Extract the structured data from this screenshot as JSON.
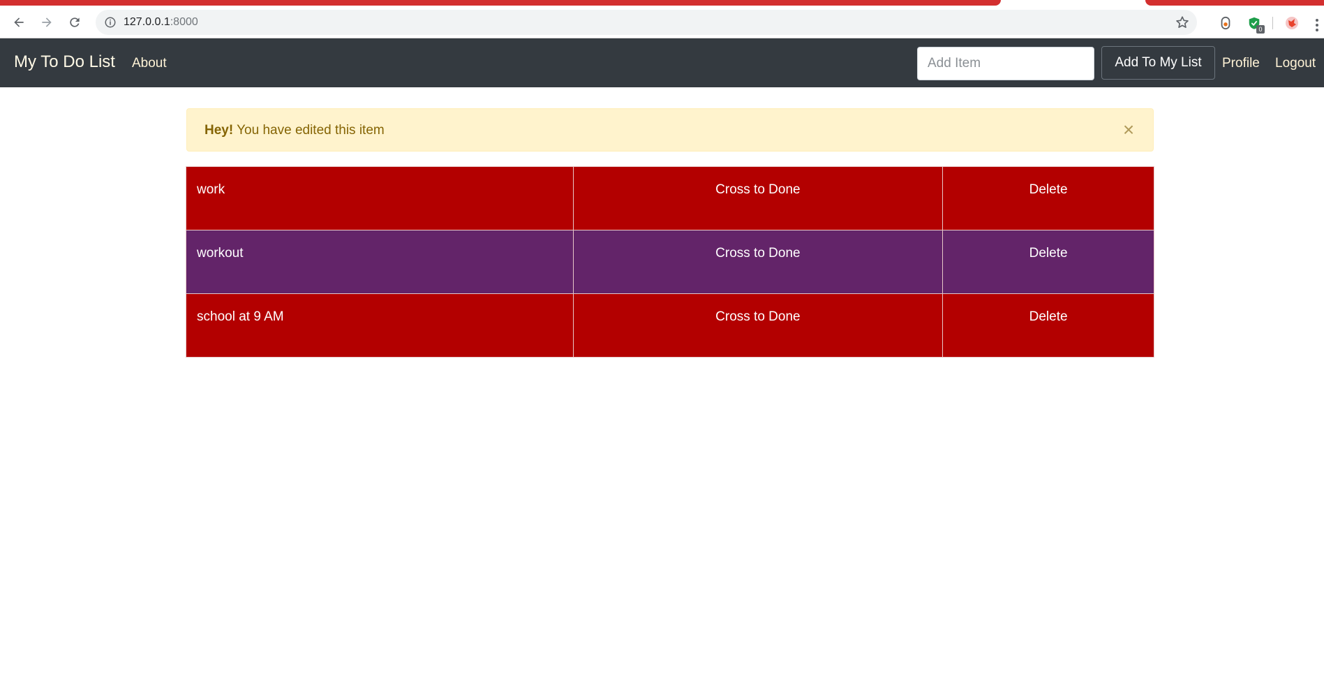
{
  "browser": {
    "url_host": "127.0.0.1",
    "url_port": ":8000",
    "extension_badge": "0",
    "tab_color": "#d32f2f"
  },
  "navbar": {
    "brand": "My To Do List",
    "about_label": "About",
    "add_item_placeholder": "Add Item",
    "add_item_value": "",
    "add_button_label": "Add To My List",
    "profile_label": "Profile",
    "logout_label": "Logout",
    "background": "#343a40"
  },
  "alert": {
    "strong": "Hey!",
    "message": " You have edited this item",
    "close_symbol": "×",
    "background": "#fff3cd"
  },
  "todos": [
    {
      "name": "work",
      "cross_label": "Cross to Done",
      "delete_label": "Delete",
      "color": "#b30000"
    },
    {
      "name": "workout",
      "cross_label": "Cross to Done",
      "delete_label": "Delete",
      "color": "#632469"
    },
    {
      "name": "school at 9 AM",
      "cross_label": "Cross to Done",
      "delete_label": "Delete",
      "color": "#b30000"
    }
  ]
}
